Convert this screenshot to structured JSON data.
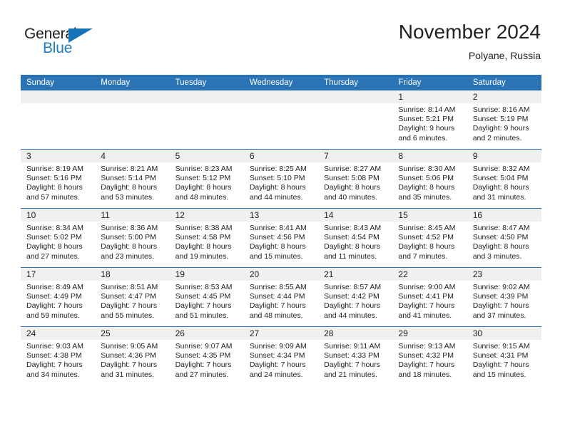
{
  "logo": {
    "word_top": "General",
    "word_bottom": "Blue",
    "triangle_color": "#1673b9",
    "blue_color": "#1f7ec0"
  },
  "header": {
    "title": "November 2024",
    "location": "Polyane, Russia"
  },
  "theme": {
    "header_blue": "#2a74b5",
    "daynum_band": "#f0f0f0",
    "text": "#222222"
  },
  "weekdays": [
    "Sunday",
    "Monday",
    "Tuesday",
    "Wednesday",
    "Thursday",
    "Friday",
    "Saturday"
  ],
  "labels": {
    "sunrise_prefix": "Sunrise:",
    "sunset_prefix": "Sunset:",
    "daylight_prefix": "Daylight:"
  },
  "weeks": [
    [
      {
        "day": "",
        "lines": []
      },
      {
        "day": "",
        "lines": []
      },
      {
        "day": "",
        "lines": []
      },
      {
        "day": "",
        "lines": []
      },
      {
        "day": "",
        "lines": []
      },
      {
        "day": "1",
        "lines": [
          "Sunrise: 8:14 AM",
          "Sunset: 5:21 PM",
          "Daylight: 9 hours",
          "and 6 minutes."
        ]
      },
      {
        "day": "2",
        "lines": [
          "Sunrise: 8:16 AM",
          "Sunset: 5:19 PM",
          "Daylight: 9 hours",
          "and 2 minutes."
        ]
      }
    ],
    [
      {
        "day": "3",
        "lines": [
          "Sunrise: 8:19 AM",
          "Sunset: 5:16 PM",
          "Daylight: 8 hours",
          "and 57 minutes."
        ]
      },
      {
        "day": "4",
        "lines": [
          "Sunrise: 8:21 AM",
          "Sunset: 5:14 PM",
          "Daylight: 8 hours",
          "and 53 minutes."
        ]
      },
      {
        "day": "5",
        "lines": [
          "Sunrise: 8:23 AM",
          "Sunset: 5:12 PM",
          "Daylight: 8 hours",
          "and 48 minutes."
        ]
      },
      {
        "day": "6",
        "lines": [
          "Sunrise: 8:25 AM",
          "Sunset: 5:10 PM",
          "Daylight: 8 hours",
          "and 44 minutes."
        ]
      },
      {
        "day": "7",
        "lines": [
          "Sunrise: 8:27 AM",
          "Sunset: 5:08 PM",
          "Daylight: 8 hours",
          "and 40 minutes."
        ]
      },
      {
        "day": "8",
        "lines": [
          "Sunrise: 8:30 AM",
          "Sunset: 5:06 PM",
          "Daylight: 8 hours",
          "and 35 minutes."
        ]
      },
      {
        "day": "9",
        "lines": [
          "Sunrise: 8:32 AM",
          "Sunset: 5:04 PM",
          "Daylight: 8 hours",
          "and 31 minutes."
        ]
      }
    ],
    [
      {
        "day": "10",
        "lines": [
          "Sunrise: 8:34 AM",
          "Sunset: 5:02 PM",
          "Daylight: 8 hours",
          "and 27 minutes."
        ]
      },
      {
        "day": "11",
        "lines": [
          "Sunrise: 8:36 AM",
          "Sunset: 5:00 PM",
          "Daylight: 8 hours",
          "and 23 minutes."
        ]
      },
      {
        "day": "12",
        "lines": [
          "Sunrise: 8:38 AM",
          "Sunset: 4:58 PM",
          "Daylight: 8 hours",
          "and 19 minutes."
        ]
      },
      {
        "day": "13",
        "lines": [
          "Sunrise: 8:41 AM",
          "Sunset: 4:56 PM",
          "Daylight: 8 hours",
          "and 15 minutes."
        ]
      },
      {
        "day": "14",
        "lines": [
          "Sunrise: 8:43 AM",
          "Sunset: 4:54 PM",
          "Daylight: 8 hours",
          "and 11 minutes."
        ]
      },
      {
        "day": "15",
        "lines": [
          "Sunrise: 8:45 AM",
          "Sunset: 4:52 PM",
          "Daylight: 8 hours",
          "and 7 minutes."
        ]
      },
      {
        "day": "16",
        "lines": [
          "Sunrise: 8:47 AM",
          "Sunset: 4:50 PM",
          "Daylight: 8 hours",
          "and 3 minutes."
        ]
      }
    ],
    [
      {
        "day": "17",
        "lines": [
          "Sunrise: 8:49 AM",
          "Sunset: 4:49 PM",
          "Daylight: 7 hours",
          "and 59 minutes."
        ]
      },
      {
        "day": "18",
        "lines": [
          "Sunrise: 8:51 AM",
          "Sunset: 4:47 PM",
          "Daylight: 7 hours",
          "and 55 minutes."
        ]
      },
      {
        "day": "19",
        "lines": [
          "Sunrise: 8:53 AM",
          "Sunset: 4:45 PM",
          "Daylight: 7 hours",
          "and 51 minutes."
        ]
      },
      {
        "day": "20",
        "lines": [
          "Sunrise: 8:55 AM",
          "Sunset: 4:44 PM",
          "Daylight: 7 hours",
          "and 48 minutes."
        ]
      },
      {
        "day": "21",
        "lines": [
          "Sunrise: 8:57 AM",
          "Sunset: 4:42 PM",
          "Daylight: 7 hours",
          "and 44 minutes."
        ]
      },
      {
        "day": "22",
        "lines": [
          "Sunrise: 9:00 AM",
          "Sunset: 4:41 PM",
          "Daylight: 7 hours",
          "and 41 minutes."
        ]
      },
      {
        "day": "23",
        "lines": [
          "Sunrise: 9:02 AM",
          "Sunset: 4:39 PM",
          "Daylight: 7 hours",
          "and 37 minutes."
        ]
      }
    ],
    [
      {
        "day": "24",
        "lines": [
          "Sunrise: 9:03 AM",
          "Sunset: 4:38 PM",
          "Daylight: 7 hours",
          "and 34 minutes."
        ]
      },
      {
        "day": "25",
        "lines": [
          "Sunrise: 9:05 AM",
          "Sunset: 4:36 PM",
          "Daylight: 7 hours",
          "and 31 minutes."
        ]
      },
      {
        "day": "26",
        "lines": [
          "Sunrise: 9:07 AM",
          "Sunset: 4:35 PM",
          "Daylight: 7 hours",
          "and 27 minutes."
        ]
      },
      {
        "day": "27",
        "lines": [
          "Sunrise: 9:09 AM",
          "Sunset: 4:34 PM",
          "Daylight: 7 hours",
          "and 24 minutes."
        ]
      },
      {
        "day": "28",
        "lines": [
          "Sunrise: 9:11 AM",
          "Sunset: 4:33 PM",
          "Daylight: 7 hours",
          "and 21 minutes."
        ]
      },
      {
        "day": "29",
        "lines": [
          "Sunrise: 9:13 AM",
          "Sunset: 4:32 PM",
          "Daylight: 7 hours",
          "and 18 minutes."
        ]
      },
      {
        "day": "30",
        "lines": [
          "Sunrise: 9:15 AM",
          "Sunset: 4:31 PM",
          "Daylight: 7 hours",
          "and 15 minutes."
        ]
      }
    ]
  ]
}
